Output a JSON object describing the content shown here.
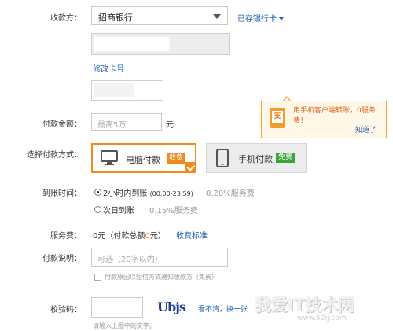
{
  "payee": {
    "label": "收款方：",
    "bank_value": "招商银行",
    "saved_cards_link": "已存银行卡",
    "modify_card_link": "修改卡号"
  },
  "amount": {
    "label": "付款金额：",
    "placeholder": "最高5万",
    "unit": "元"
  },
  "tooltip": {
    "message": "用手机客户端转账，0服务费！",
    "icon_char": "支",
    "dismiss": "知道了"
  },
  "payment_method": {
    "label": "选择付款方式：",
    "pc_label": "电脑付款",
    "pc_badge": "收费",
    "mobile_label": "手机付款",
    "mobile_badge": "免费",
    "pc_badge_color": "#f08a1d",
    "mobile_badge_color": "#3aa53a"
  },
  "arrival": {
    "label": "到账时间：",
    "option1": "2小时内到账",
    "option1_hours": "(00:00-23:59)",
    "option1_fee": "0.20%服务费",
    "option2": "次日到账",
    "option2_fee": "0.15%服务费"
  },
  "service_fee": {
    "label": "服务费：",
    "value_prefix": "0元（付款总额",
    "value_num": "0",
    "value_suffix": "元）",
    "standard_link": "收费标准"
  },
  "description": {
    "label": "付款说明：",
    "placeholder": "可选（20字以内）",
    "sms_option": "付款原因以短信方式通知收款方（免费）"
  },
  "verify": {
    "label": "校验码：",
    "captcha_text": "Ubjs",
    "refresh_link": "看不清，换一张",
    "hint": "请输入上图中的文字。"
  },
  "watermark": {
    "text": "我爱IT技术网",
    "url": "www.52ij.com"
  }
}
